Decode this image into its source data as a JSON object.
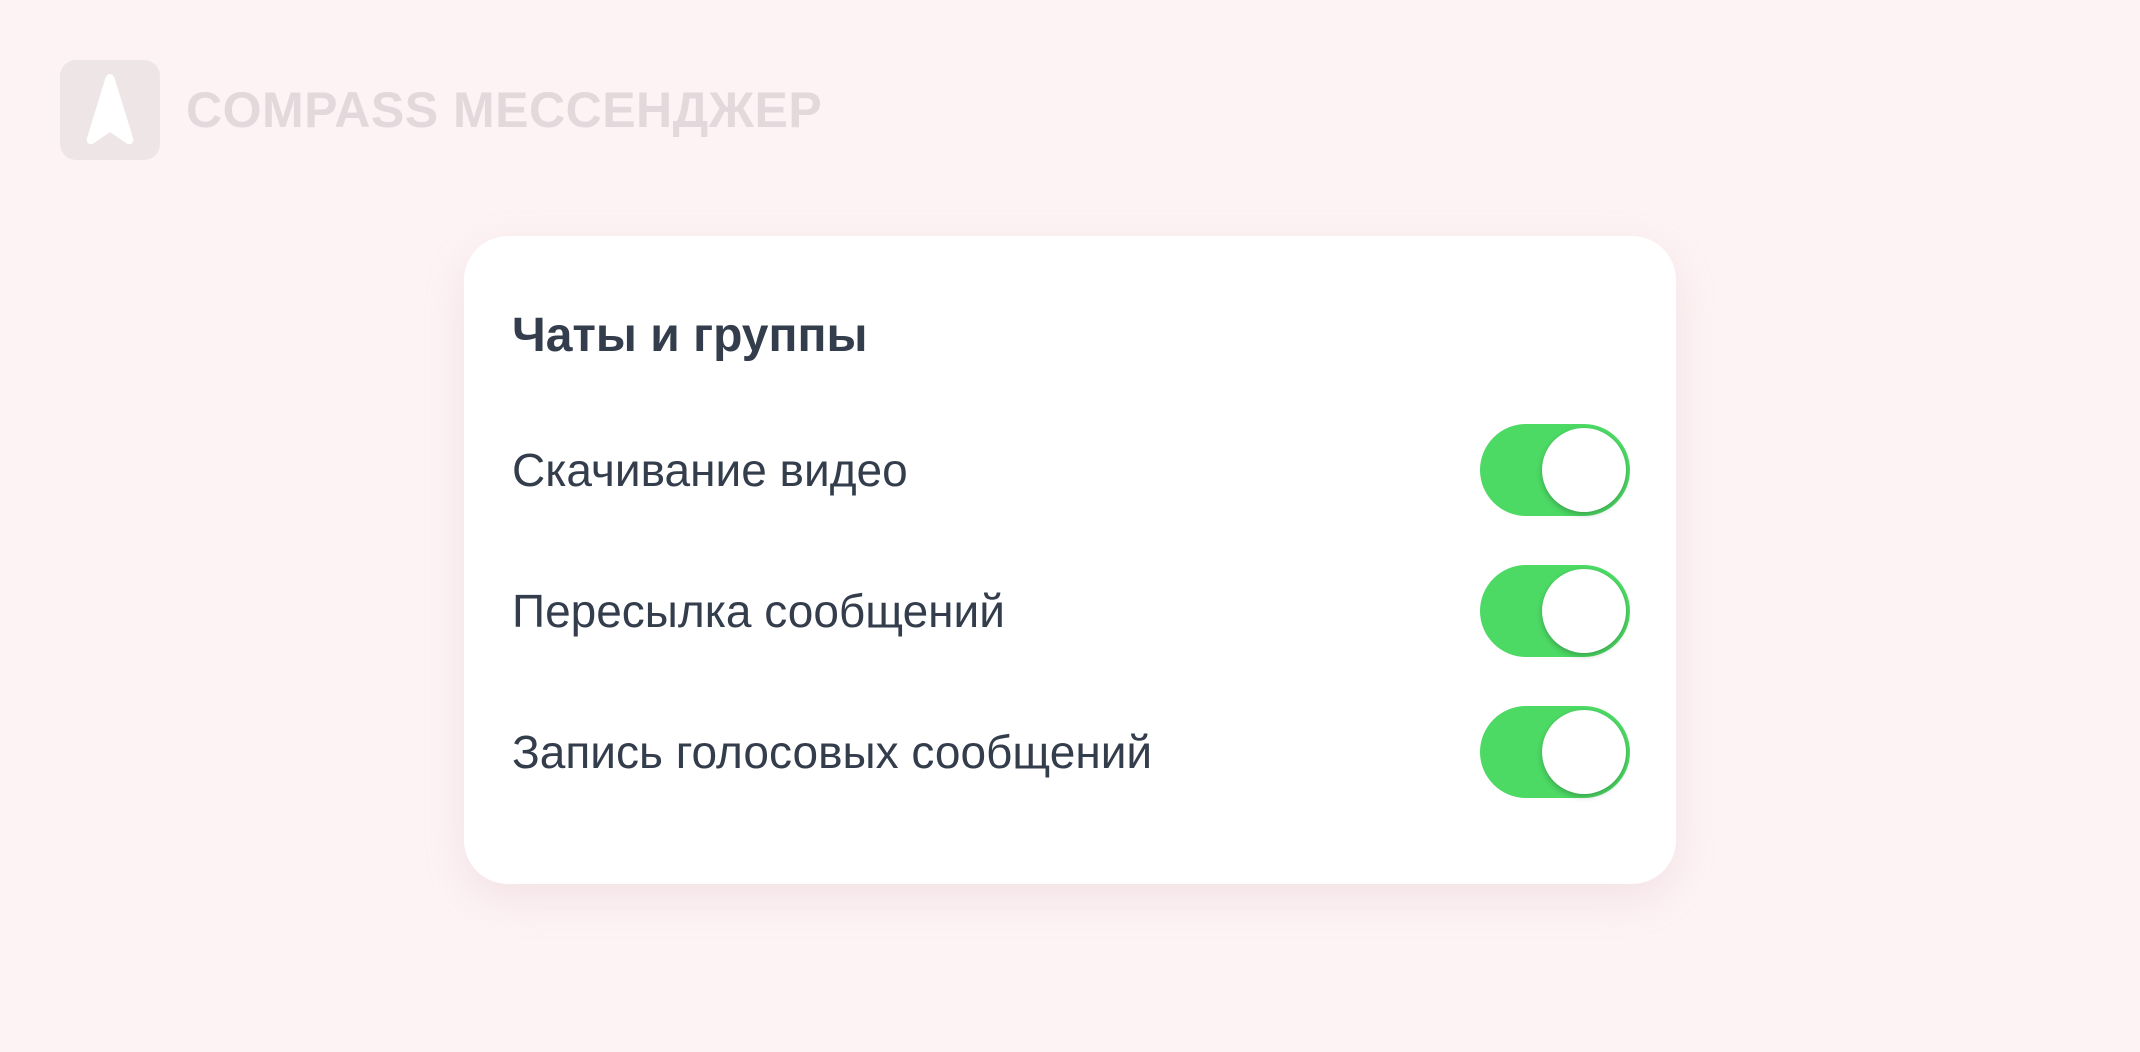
{
  "brand": {
    "name": "COMPASS МЕССЕНДЖЕР",
    "logo_icon": "compass-arrow-icon"
  },
  "settings": {
    "section_title": "Чаты и группы",
    "items": [
      {
        "label": "Скачивание видео",
        "enabled": true
      },
      {
        "label": "Пересылка сообщений",
        "enabled": true
      },
      {
        "label": "Запись голосовых сообщений",
        "enabled": true
      }
    ]
  },
  "colors": {
    "background": "#fdf3f4",
    "card": "#ffffff",
    "text": "#333d4c",
    "toggle_on": "#4cd964",
    "brand_faded": "#e3d8db"
  }
}
